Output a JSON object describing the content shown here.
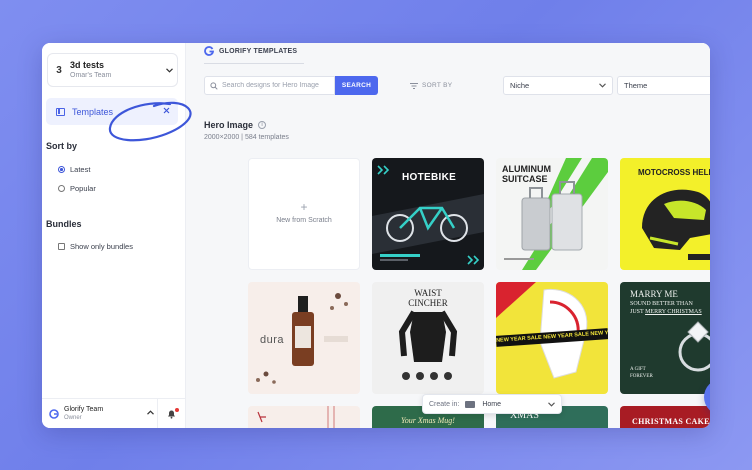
{
  "team": {
    "number": "3",
    "name": "3d tests",
    "subtitle": "Omar's Team"
  },
  "nav": {
    "templates_label": "Templates"
  },
  "sort": {
    "title": "Sort by",
    "options": [
      "Latest",
      "Popular"
    ],
    "selected": "Latest"
  },
  "bundles": {
    "title": "Bundles",
    "checkbox_label": "Show only bundles",
    "checked": false
  },
  "account": {
    "name": "Glorify Team",
    "role": "Owner"
  },
  "brand": {
    "title": "GLORIFY TEMPLATES"
  },
  "search": {
    "placeholder": "Search designs for Hero Image",
    "button_label": "SEARCH"
  },
  "filters": {
    "sort_by_label": "SORT BY",
    "niche_value": "Niche",
    "theme_value": "Theme"
  },
  "page": {
    "title": "Hero Image",
    "info_glyph": "i",
    "meta": "2000×2000 | 584 templates"
  },
  "scratch": {
    "plus": "+",
    "label": "New from Scratch"
  },
  "templates": {
    "hotebike": {
      "title": "HOTEBIKE"
    },
    "suitcase": {
      "title_line1": "ALUMINUM",
      "title_line2": "SUITCASE"
    },
    "helmet": {
      "title": "MOTOCROSS HELMET"
    },
    "dura": {
      "brand": "dura"
    },
    "cincher": {
      "title_line1": "WAIST",
      "title_line2": "CINCHER"
    },
    "sale": {
      "banner": "NEW YEAR SALE NEW YEAR SALE NEW YEAR SALE"
    },
    "marry": {
      "line1": "MARRY ME",
      "line2": "SOUND BETTER THAN",
      "line3": "JUST",
      "line4": "MERRY CHRISTMAS",
      "line5": "A GIFT",
      "line6": "FOREVER"
    },
    "xmas_mug": {
      "title": "Your Xmas Mug!"
    },
    "xmas": {
      "title": "XMAS"
    },
    "xmas_cake": {
      "title": "CHRISTMAS CAKE?"
    }
  },
  "create_in": {
    "label": "Create in:",
    "value": "Home"
  },
  "colors": {
    "accent": "#4d68ee",
    "background": "#7f8ef0"
  }
}
